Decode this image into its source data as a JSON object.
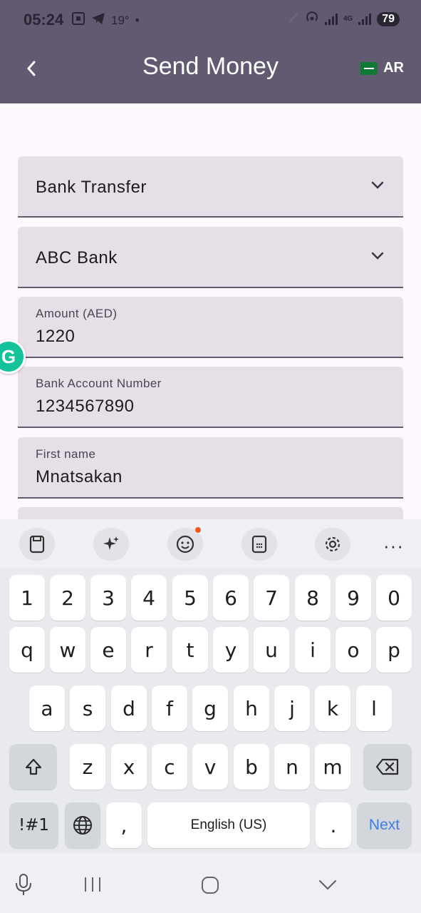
{
  "status_bar": {
    "time": "05:24",
    "temperature": "19°",
    "battery": "79",
    "network": "4G"
  },
  "app_bar": {
    "title": "Send Money",
    "language_label": "AR"
  },
  "form": {
    "transfer_type": "Bank Transfer",
    "bank": "ABC Bank",
    "amount_label": "Amount (AED)",
    "amount_value": "1220",
    "account_label": "Bank Account Number",
    "account_value": "1234567890",
    "first_name_label": "First name",
    "first_name_value": "Mnatsakan"
  },
  "keyboard": {
    "number_row": [
      "1",
      "2",
      "3",
      "4",
      "5",
      "6",
      "7",
      "8",
      "9",
      "0"
    ],
    "row1": [
      "q",
      "w",
      "e",
      "r",
      "t",
      "y",
      "u",
      "i",
      "o",
      "p"
    ],
    "row2": [
      "a",
      "s",
      "d",
      "f",
      "g",
      "h",
      "j",
      "k",
      "l"
    ],
    "row3": [
      "z",
      "x",
      "c",
      "v",
      "b",
      "n",
      "m"
    ],
    "symbols_label": "!#1",
    "comma_label": ",",
    "space_label": "English (US)",
    "period_label": ".",
    "action_label": "Next"
  },
  "colors": {
    "app_bar": "#615a70",
    "field_bg": "#e6dfe8",
    "accent_next": "#3f7de2"
  }
}
